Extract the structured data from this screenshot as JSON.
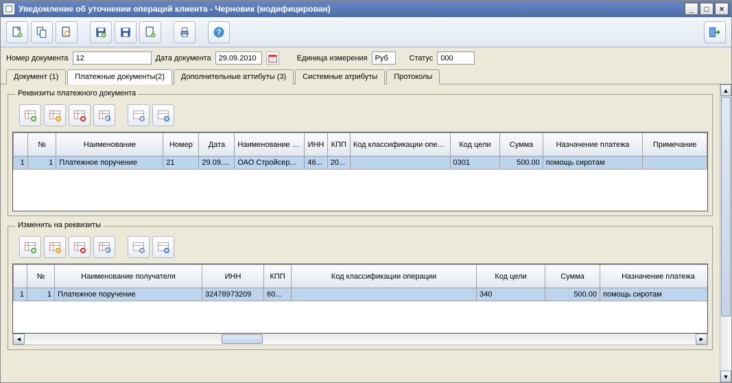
{
  "window": {
    "title": "Уведомление об уточнении операций клиента - Черновик (модифицирован)"
  },
  "form": {
    "doc_number_label": "Номер документа",
    "doc_number_value": "12",
    "doc_date_label": "Дата документа",
    "doc_date_value": "29.09.2010",
    "unit_label": "Единица измерения",
    "unit_value": "Руб",
    "status_label": "Статус",
    "status_value": "000"
  },
  "tabs": [
    "Документ (1)",
    "Платежные документы(2)",
    "Дополнительные аттибуты (3)",
    "Системные атрибуты",
    "Протоколы"
  ],
  "group1": {
    "legend": "Реквизиты платежного документа",
    "cols": [
      "",
      "№",
      "Наименование",
      "Номер",
      "Дата",
      "Наименование получателя",
      "ИНН",
      "КПП",
      "Код классификации операции",
      "Код цели",
      "Сумма",
      "Назначение платежа",
      "Примечание"
    ],
    "row": {
      "idx": "1",
      "num": "1",
      "name": "Платежное поручение",
      "number": "21",
      "date": "29.09....",
      "recipient": "ОАО Стройсер...",
      "inn": "46...",
      "kpp": "20...",
      "class_code": "",
      "goal_code": "0301",
      "sum": "500.00",
      "purpose": "помощь сиротам",
      "note": ""
    }
  },
  "group2": {
    "legend": "Изменить на реквизиты",
    "cols": [
      "",
      "№",
      "Наименование получателя",
      "ИНН",
      "КПП",
      "Код классификации операции",
      "Код цели",
      "Сумма",
      "Назначение платежа"
    ],
    "row": {
      "idx": "1",
      "num": "1",
      "recipient": "Платежное поручение",
      "inn": "32478973209",
      "kpp": "60...",
      "class_code": "",
      "goal_code": "340",
      "sum": "500.00",
      "purpose": "помощь сиротам"
    }
  }
}
